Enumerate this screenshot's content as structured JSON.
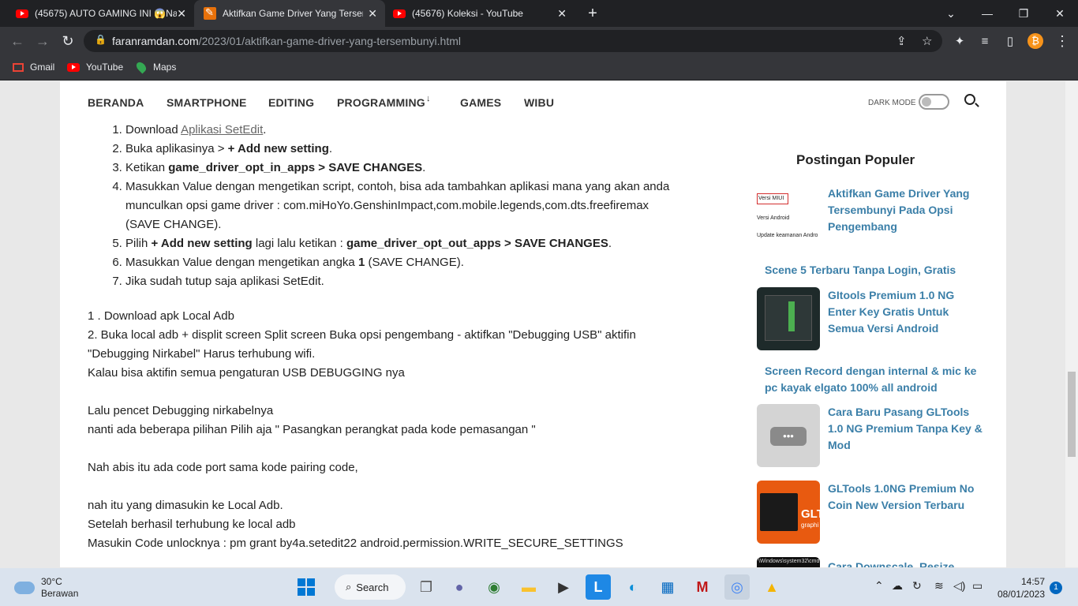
{
  "tabs": [
    {
      "title": "(45675) AUTO GAMING INI 😱Na",
      "icon": "youtube-icon"
    },
    {
      "title": "Aktifkan Game Driver Yang Tersem",
      "icon": "pen-icon",
      "active": true
    },
    {
      "title": "(45676) Koleksi - YouTube",
      "icon": "youtube-icon"
    }
  ],
  "new_tab": "+",
  "window_controls": {
    "minimize": "—",
    "restore": "❐",
    "close": "✕",
    "chevron": "⌄"
  },
  "address": {
    "domain": "faranramdan.com",
    "path": "/2023/01/aktifkan-game-driver-yang-tersembunyi.html"
  },
  "bookmarks": [
    {
      "label": "Gmail",
      "icon": "gmail-icon"
    },
    {
      "label": "YouTube",
      "icon": "youtube-icon"
    },
    {
      "label": "Maps",
      "icon": "maps-icon"
    }
  ],
  "site_nav": {
    "items": [
      "BERANDA",
      "SMARTPHONE",
      "EDITING",
      "PROGRAMMING",
      "GAMES",
      "WIBU"
    ],
    "programming_arrow": "↓",
    "dark_mode_label": "DARK MODE"
  },
  "article": {
    "steps": [
      {
        "pre": "Download ",
        "link": "Aplikasi SetEdit",
        "post": "."
      },
      {
        "pre": "Buka aplikasinya > ",
        "bold": "+ Add new setting",
        "post": "."
      },
      {
        "pre": "Ketikan ",
        "bold": "game_driver_opt_in_apps > SAVE CHANGES",
        "post": "."
      },
      {
        "pre": "Masukkan Value dengan mengetikan script, contoh, bisa ada tambahkan aplikasi mana yang akan anda munculkan opsi game driver  : com.miHoYo.GenshinImpact,com.mobile.legends,com.dts.freefiremax (SAVE CHANGE)."
      },
      {
        "pre": "Pilih ",
        "bold": "+ Add new setting",
        "mid": " lagi lalu ketikan : ",
        "bold2": "game_driver_opt_out_apps > SAVE CHANGES",
        "post": "."
      },
      {
        "pre": "Masukkan Value dengan mengetikan angka ",
        "bold": "1",
        "post": " (SAVE CHANGE)."
      },
      {
        "pre": "Jika sudah tutup saja aplikasi SetEdit."
      }
    ],
    "para1": "1 . Download apk Local Adb",
    "para2": "2. Buka local adb + displit screen Split screen Buka opsi pengembang - aktifkan \"Debugging USB\" aktifin \"Debugging Nirkabel\" Harus terhubung wifi.",
    "para3": "Kalau bisa aktifin semua pengaturan USB DEBUGGING nya",
    "para4": "Lalu pencet Debugging nirkabelnya",
    "para5": "nanti ada beberapa pilihan Pilih aja \" Pasangkan perangkat pada kode pemasangan \"",
    "para6": "Nah abis itu ada code port sama kode pairing code,",
    "para7": "nah itu yang dimasukin ke Local Adb.",
    "para8": "Setelah berhasil terhubung ke local adb",
    "para9": "Masukin Code unlocknya : pm grant by4a.setedit22 android.permission.WRITE_SECURE_SETTINGS"
  },
  "sidebar": {
    "title": "Postingan Populer",
    "posts": [
      {
        "title": "Aktifkan Game Driver Yang Tersembunyi Pada Opsi Pengembang",
        "thumb_lines": [
          "Versi MIUI",
          "Versi Android",
          "Update keamanan Andro"
        ]
      },
      {
        "title": "Scene 5 Terbaru Tanpa Login, Gratis"
      },
      {
        "title": "GItools Premium 1.0 NG Enter Key Gratis Untuk Semua Versi Android"
      },
      {
        "title": "Screen Record dengan internal & mic ke pc kayak elgato 100% all android"
      },
      {
        "title": "Cara Baru Pasang GLTools 1.0 NG Premium Tanpa Key & Mod",
        "thumb_text": "•••"
      },
      {
        "title": "GLTools 1.0NG Premium No Coin New Version Terbaru",
        "thumb_text": "GLT",
        "thumb_sub": "graphi"
      },
      {
        "title": "Cara Downscale, Resize,",
        "thumb_text": "\\Windows\\system32\\cmd"
      }
    ]
  },
  "taskbar": {
    "weather_temp": "30°C",
    "weather_desc": "Berawan",
    "search_label": "Search",
    "time": "14:57",
    "date": "08/01/2023",
    "notifications": "1"
  }
}
